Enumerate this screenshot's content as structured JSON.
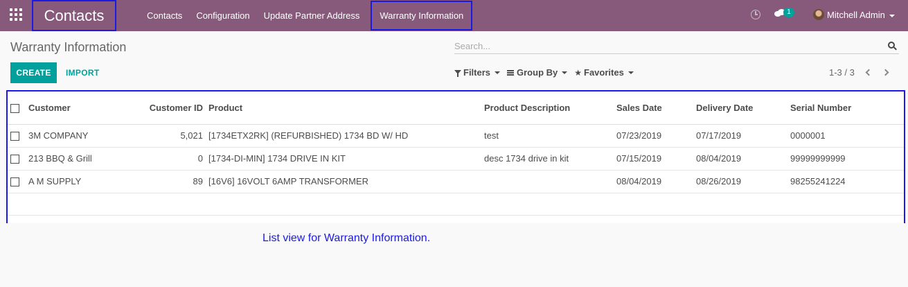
{
  "navbar": {
    "app_name": "Contacts",
    "menu": [
      "Contacts",
      "Configuration",
      "Update Partner Address",
      "Warranty Information"
    ],
    "message_count": "1",
    "user_name": "Mitchell Admin"
  },
  "control_panel": {
    "breadcrumb": "Warranty Information",
    "search_placeholder": "Search...",
    "create_label": "CREATE",
    "import_label": "IMPORT",
    "filters_label": "Filters",
    "group_by_label": "Group By",
    "favorites_label": "Favorites",
    "pager": "1-3 / 3"
  },
  "list": {
    "columns": [
      "Customer",
      "Customer ID",
      "Product",
      "Product Description",
      "Sales Date",
      "Delivery Date",
      "Serial Number"
    ],
    "rows": [
      [
        "3M COMPANY",
        "5,021",
        "[1734ETX2RK] (REFURBISHED) 1734 BD W/ HD",
        "test",
        "07/23/2019",
        "07/17/2019",
        "0000001"
      ],
      [
        "213 BBQ & Grill",
        "0",
        "[1734-DI-MIN] 1734 DRIVE IN KIT",
        "desc 1734 drive in kit",
        "07/15/2019",
        "08/04/2019",
        "99999999999"
      ],
      [
        "A M SUPPLY",
        "89",
        "[16V6] 16VOLT 6AMP TRANSFORMER",
        "",
        "08/04/2019",
        "08/26/2019",
        "98255241224"
      ]
    ]
  },
  "caption": "List view for Warranty Information.",
  "colors": {
    "navbar": "#875a7b",
    "primary": "#00a09d",
    "highlight": "#1a1ae6"
  }
}
